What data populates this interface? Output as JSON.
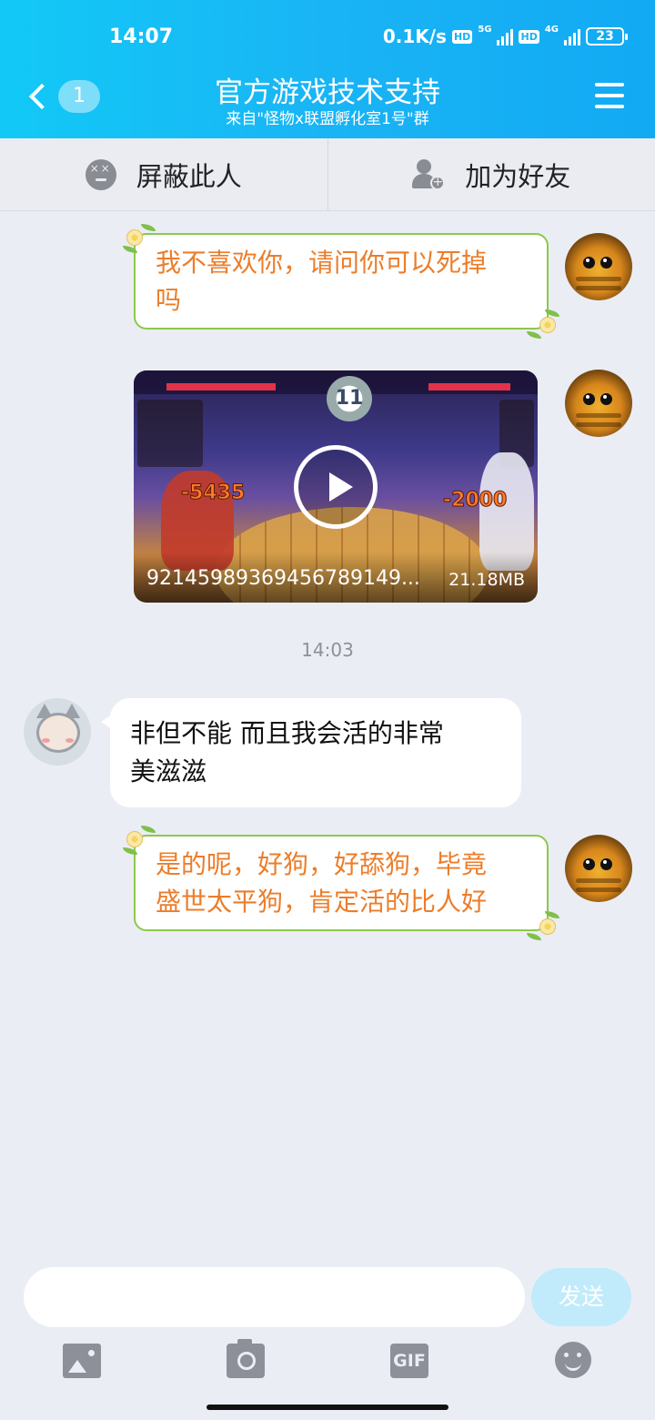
{
  "status_bar": {
    "time": "14:07",
    "net_speed": "0.1K/s",
    "hd1": "HD",
    "net1": "5G",
    "hd2": "HD",
    "net2": "4G",
    "battery": "23"
  },
  "header": {
    "unread_count": "1",
    "title": "官方游戏技术支持",
    "subtitle": "来自\"怪物x联盟孵化室1号\"群"
  },
  "actions": {
    "block": "屏蔽此人",
    "add_friend": "加为好友"
  },
  "messages": [
    {
      "side": "right",
      "type": "text",
      "text": "我不喜欢你，请问你可以死掉吗",
      "line1": "我不喜欢你，请问你可以死掉",
      "line2": "吗"
    },
    {
      "side": "right",
      "type": "video",
      "file_name": "92145989369456789149...",
      "file_size": "21.18MB",
      "damage_left": "-5435",
      "damage_right": "-2000",
      "round": "11"
    },
    {
      "type": "timestamp",
      "text": "14:03"
    },
    {
      "side": "left",
      "type": "text",
      "line1": "非但不能 而且我会活的非常",
      "line2": "美滋滋"
    },
    {
      "side": "right",
      "type": "text",
      "line1": "是的呢，好狗，好舔狗，毕竟",
      "line2": "盛世太平狗，肯定活的比人好"
    }
  ],
  "input": {
    "value": "",
    "send_label": "发送",
    "gif_label": "GIF"
  },
  "colors": {
    "header": "#16b4f5",
    "bubble_border": "#8cc94a",
    "bubble_text": "#ec7d2a",
    "send_bg": "#c1ebfb"
  },
  "icons": [
    "back-chevron-icon",
    "menu-icon",
    "block-icon",
    "add-friend-icon",
    "play-icon",
    "image-icon",
    "camera-icon",
    "gif-icon",
    "emoji-icon"
  ]
}
